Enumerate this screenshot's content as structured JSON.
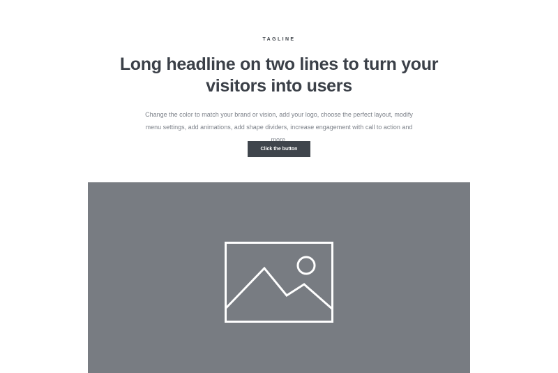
{
  "hero": {
    "tagline": "TAGLINE",
    "headline": "Long headline on two lines to turn your visitors into users",
    "description": "Change the color to match your brand or vision, add your logo, choose the perfect layout, modify menu settings, add animations, add shape dividers, increase engagement with call to action and more.",
    "button_label": "Click the button"
  },
  "media": {
    "icon": "image-placeholder-icon"
  },
  "colors": {
    "text_dark": "#3b4048",
    "text_muted": "#7d828a",
    "button_bg": "#3f454c",
    "placeholder_bg": "#787c82"
  }
}
